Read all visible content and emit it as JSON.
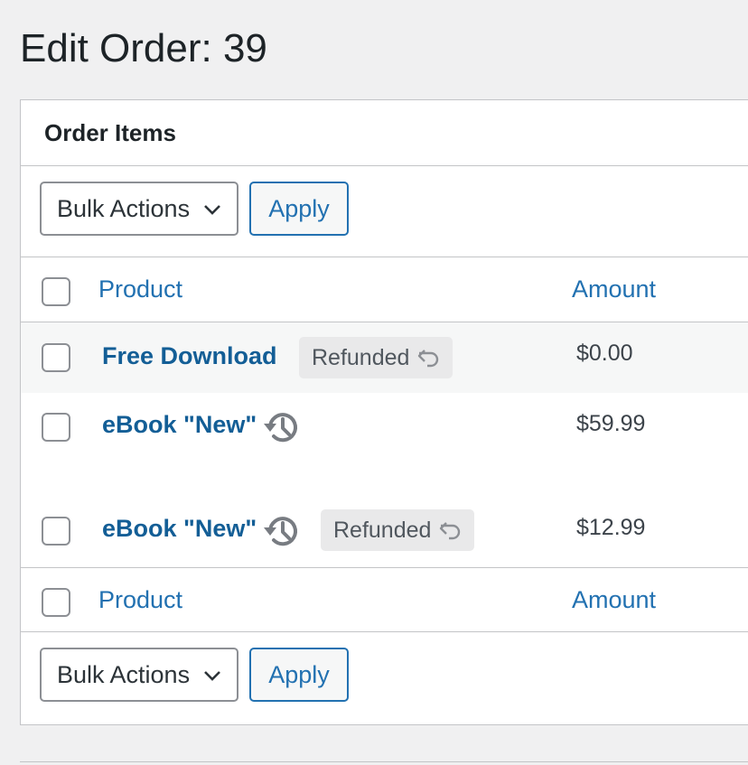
{
  "page": {
    "title": "Edit Order: 39"
  },
  "box": {
    "title": "Order Items"
  },
  "bulk": {
    "label": "Bulk Actions",
    "apply": "Apply"
  },
  "columns": {
    "product": "Product",
    "amount": "Amount"
  },
  "items": [
    {
      "name": "Free Download",
      "status": "Refunded",
      "amount": "$0.00",
      "has_history_icon": false
    },
    {
      "name": "eBook \"New\"",
      "status": "",
      "amount": "$59.99",
      "has_history_icon": true
    },
    {
      "name": "eBook \"New\"",
      "status": "Refunded",
      "amount": "$12.99",
      "has_history_icon": true
    }
  ],
  "colors": {
    "link": "#2271b1",
    "item_link": "#135e96",
    "badge_bg": "#e9e9ea",
    "border": "#c3c4c7"
  }
}
